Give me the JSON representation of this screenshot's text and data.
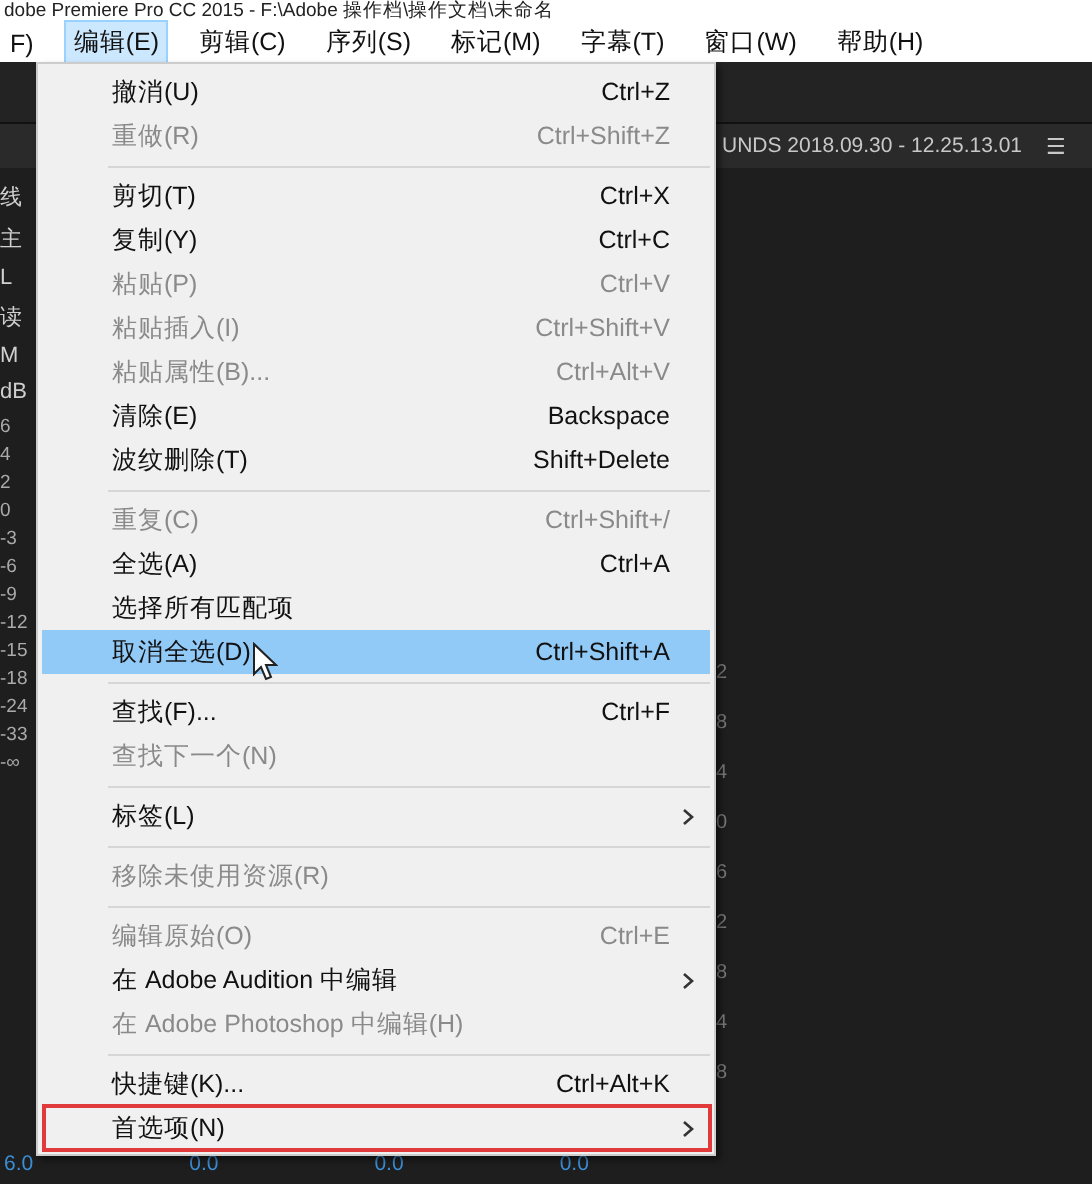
{
  "window": {
    "title": "dobe Premiere Pro CC 2015 - F:\\Adobe 操作档\\操作文档\\未命名"
  },
  "menubar": [
    {
      "label": "F)",
      "selected": false
    },
    {
      "label": "编辑(E)",
      "selected": true
    },
    {
      "label": "剪辑(C)",
      "selected": false
    },
    {
      "label": "序列(S)",
      "selected": false
    },
    {
      "label": "标记(M)",
      "selected": false
    },
    {
      "label": "字幕(T)",
      "selected": false
    },
    {
      "label": "窗口(W)",
      "selected": false
    },
    {
      "label": "帮助(H)",
      "selected": false
    }
  ],
  "background": {
    "panel_title": "UNDS 2018.09.30 - 12.25.13.01",
    "panel_menu": "☰",
    "left_labels": [
      "线",
      "主",
      "L",
      "读",
      "M",
      "dB"
    ],
    "scale": [
      "6",
      "4",
      "2",
      "0",
      "-3",
      "-6",
      "-9",
      "-12",
      "-15",
      "-18",
      "-24",
      "-33",
      "-∞"
    ],
    "right_ticks": [
      "2",
      "8",
      "4",
      "0",
      "6",
      "2",
      "8",
      "4",
      "8"
    ],
    "bottom_values": [
      "6.0",
      "0.0",
      "0.0",
      "0.0"
    ]
  },
  "menu": {
    "items": [
      {
        "kind": "item",
        "label": "撤消(U)",
        "shortcut": "Ctrl+Z",
        "disabled": false,
        "selected": false
      },
      {
        "kind": "item",
        "label": "重做(R)",
        "shortcut": "Ctrl+Shift+Z",
        "disabled": true,
        "selected": false
      },
      {
        "kind": "separator"
      },
      {
        "kind": "item",
        "label": "剪切(T)",
        "shortcut": "Ctrl+X",
        "disabled": false,
        "selected": false
      },
      {
        "kind": "item",
        "label": "复制(Y)",
        "shortcut": "Ctrl+C",
        "disabled": false,
        "selected": false
      },
      {
        "kind": "item",
        "label": "粘贴(P)",
        "shortcut": "Ctrl+V",
        "disabled": true,
        "selected": false
      },
      {
        "kind": "item",
        "label": "粘贴插入(I)",
        "shortcut": "Ctrl+Shift+V",
        "disabled": true,
        "selected": false
      },
      {
        "kind": "item",
        "label": "粘贴属性(B)...",
        "shortcut": "Ctrl+Alt+V",
        "disabled": true,
        "selected": false
      },
      {
        "kind": "item",
        "label": "清除(E)",
        "shortcut": "Backspace",
        "disabled": false,
        "selected": false
      },
      {
        "kind": "item",
        "label": "波纹删除(T)",
        "shortcut": "Shift+Delete",
        "disabled": false,
        "selected": false
      },
      {
        "kind": "separator"
      },
      {
        "kind": "item",
        "label": "重复(C)",
        "shortcut": "Ctrl+Shift+/",
        "disabled": true,
        "selected": false
      },
      {
        "kind": "item",
        "label": "全选(A)",
        "shortcut": "Ctrl+A",
        "disabled": false,
        "selected": false
      },
      {
        "kind": "item",
        "label": "选择所有匹配项",
        "disabled": false,
        "selected": false
      },
      {
        "kind": "item",
        "label": "取消全选(D)",
        "shortcut": "Ctrl+Shift+A",
        "disabled": false,
        "selected": true,
        "pointer": true
      },
      {
        "kind": "separator"
      },
      {
        "kind": "item",
        "label": "查找(F)...",
        "shortcut": "Ctrl+F",
        "disabled": false,
        "selected": false
      },
      {
        "kind": "item",
        "label": "查找下一个(N)",
        "disabled": true,
        "selected": false
      },
      {
        "kind": "separator"
      },
      {
        "kind": "item",
        "label": "标签(L)",
        "disabled": false,
        "selected": false,
        "submenu": true
      },
      {
        "kind": "separator"
      },
      {
        "kind": "item",
        "label": "移除未使用资源(R)",
        "disabled": true,
        "selected": false
      },
      {
        "kind": "separator"
      },
      {
        "kind": "item",
        "label": "编辑原始(O)",
        "shortcut": "Ctrl+E",
        "disabled": true,
        "selected": false
      },
      {
        "kind": "item",
        "label": "在 Adobe Audition 中编辑",
        "disabled": false,
        "selected": false,
        "submenu": true
      },
      {
        "kind": "item",
        "label": "在 Adobe Photoshop 中编辑(H)",
        "disabled": true,
        "selected": false
      },
      {
        "kind": "separator"
      },
      {
        "kind": "item",
        "label": "快捷键(K)...",
        "shortcut": "Ctrl+Alt+K",
        "disabled": false,
        "selected": false
      },
      {
        "kind": "item",
        "label": "首选项(N)",
        "disabled": false,
        "selected": false,
        "submenu": true,
        "outlined": true
      }
    ]
  }
}
